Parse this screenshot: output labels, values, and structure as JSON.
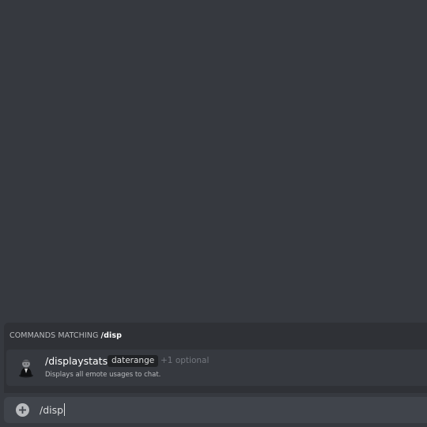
{
  "autocomplete": {
    "header_prefix": "COMMANDS MATCHING ",
    "query": "/disp",
    "items": [
      {
        "avatar_icon": "bot-avatar-icon",
        "command": "/displaystats",
        "param": "daterange",
        "optional": "+1 optional",
        "description": "Displays all emote usages to chat."
      }
    ]
  },
  "input": {
    "attach_icon": "plus-circle-icon",
    "value": "/disp"
  },
  "colors": {
    "background": "#36393f",
    "panel": "#2f3136",
    "input_bg": "#40444b",
    "text_primary": "#ffffff",
    "text_muted": "#72767d"
  }
}
